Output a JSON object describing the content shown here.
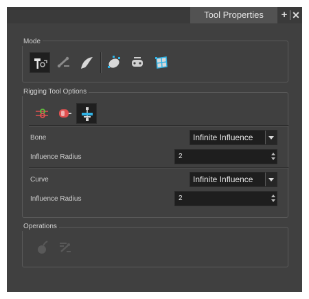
{
  "panel": {
    "tab_title": "Tool Properties",
    "add_glyph": "+",
    "close_glyph": "✕"
  },
  "mode": {
    "title": "Mode",
    "tools": [
      {
        "icon": "rigging-hammer-icon",
        "active": true
      },
      {
        "icon": "bone-icon",
        "active": false
      },
      {
        "icon": "curve-icon",
        "active": false
      },
      {
        "icon": "envelope-icon",
        "active": false
      },
      {
        "icon": "game-bone-icon",
        "active": false
      },
      {
        "icon": "grid-deformer-icon",
        "active": false
      }
    ]
  },
  "rigging": {
    "title": "Rigging Tool Options",
    "tools": [
      {
        "icon": "bone-offset-icon",
        "active": false
      },
      {
        "icon": "curve-offset-icon",
        "active": false
      },
      {
        "icon": "influence-icon",
        "active": true
      }
    ],
    "bone_label": "Bone",
    "bone_value": "Infinite Influence",
    "bone_radius_label": "Influence Radius",
    "bone_radius_value": "2",
    "curve_label": "Curve",
    "curve_value": "Infinite Influence",
    "curve_radius_label": "Influence Radius",
    "curve_radius_value": "2"
  },
  "operations": {
    "title": "Operations",
    "tools": [
      {
        "icon": "convert-bomb-icon",
        "enabled": false
      },
      {
        "icon": "rig-transfer-icon",
        "enabled": false
      }
    ]
  },
  "colors": {
    "panel_bg": "#404040",
    "field_bg": "#1e1e1e",
    "accent_blue": "#2fb3e6"
  }
}
